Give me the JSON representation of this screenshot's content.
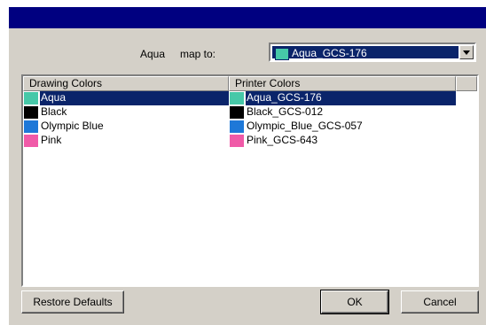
{
  "map_row": {
    "selected_color": "Aqua",
    "map_to_label": "map to:",
    "combo_value": "Aqua_GCS-176",
    "combo_swatch": "#46c8a8"
  },
  "table": {
    "headers": {
      "drawing": "Drawing Colors",
      "printer": "Printer Colors"
    },
    "rows": [
      {
        "drawing": "Aqua",
        "drawing_color": "#46c8a8",
        "printer": "Aqua_GCS-176",
        "printer_color": "#46c8a8",
        "selected": true
      },
      {
        "drawing": "Black",
        "drawing_color": "#000000",
        "printer": "Black_GCS-012",
        "printer_color": "#000000",
        "selected": false
      },
      {
        "drawing": "Olympic Blue",
        "drawing_color": "#1e78d8",
        "printer": "Olympic_Blue_GCS-057",
        "printer_color": "#1e78d8",
        "selected": false
      },
      {
        "drawing": "Pink",
        "drawing_color": "#f05aa8",
        "printer": "Pink_GCS-643",
        "printer_color": "#f05aa8",
        "selected": false
      }
    ]
  },
  "buttons": {
    "restore": "Restore Defaults",
    "ok": "OK",
    "cancel": "Cancel"
  },
  "colors": {
    "title_bar": "#000080",
    "selection": "#0a246a",
    "dialog_bg": "#d4d0c8"
  }
}
